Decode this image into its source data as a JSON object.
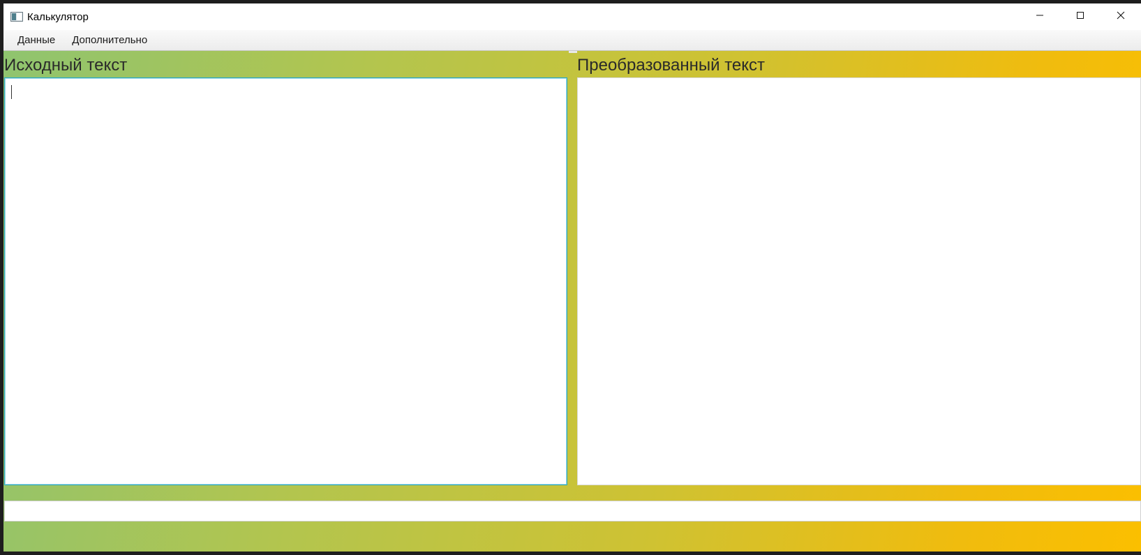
{
  "window": {
    "title": "Калькулятор",
    "icon": "app-window-icon",
    "controls": {
      "minimize_icon": "minimize-icon",
      "maximize_icon": "maximize-icon",
      "close_icon": "close-icon"
    }
  },
  "menu": {
    "items": [
      {
        "label": "Данные"
      },
      {
        "label": "Дополнительно"
      }
    ]
  },
  "left_panel": {
    "title": "Исходный текст",
    "value": ""
  },
  "right_panel": {
    "title": "Преобразованный текст",
    "value": ""
  },
  "bottom_field": {
    "value": ""
  },
  "colors": {
    "gradient_start": "#8fc46f",
    "gradient_end": "#fbbf00",
    "focus_border": "#2aa8c0"
  }
}
